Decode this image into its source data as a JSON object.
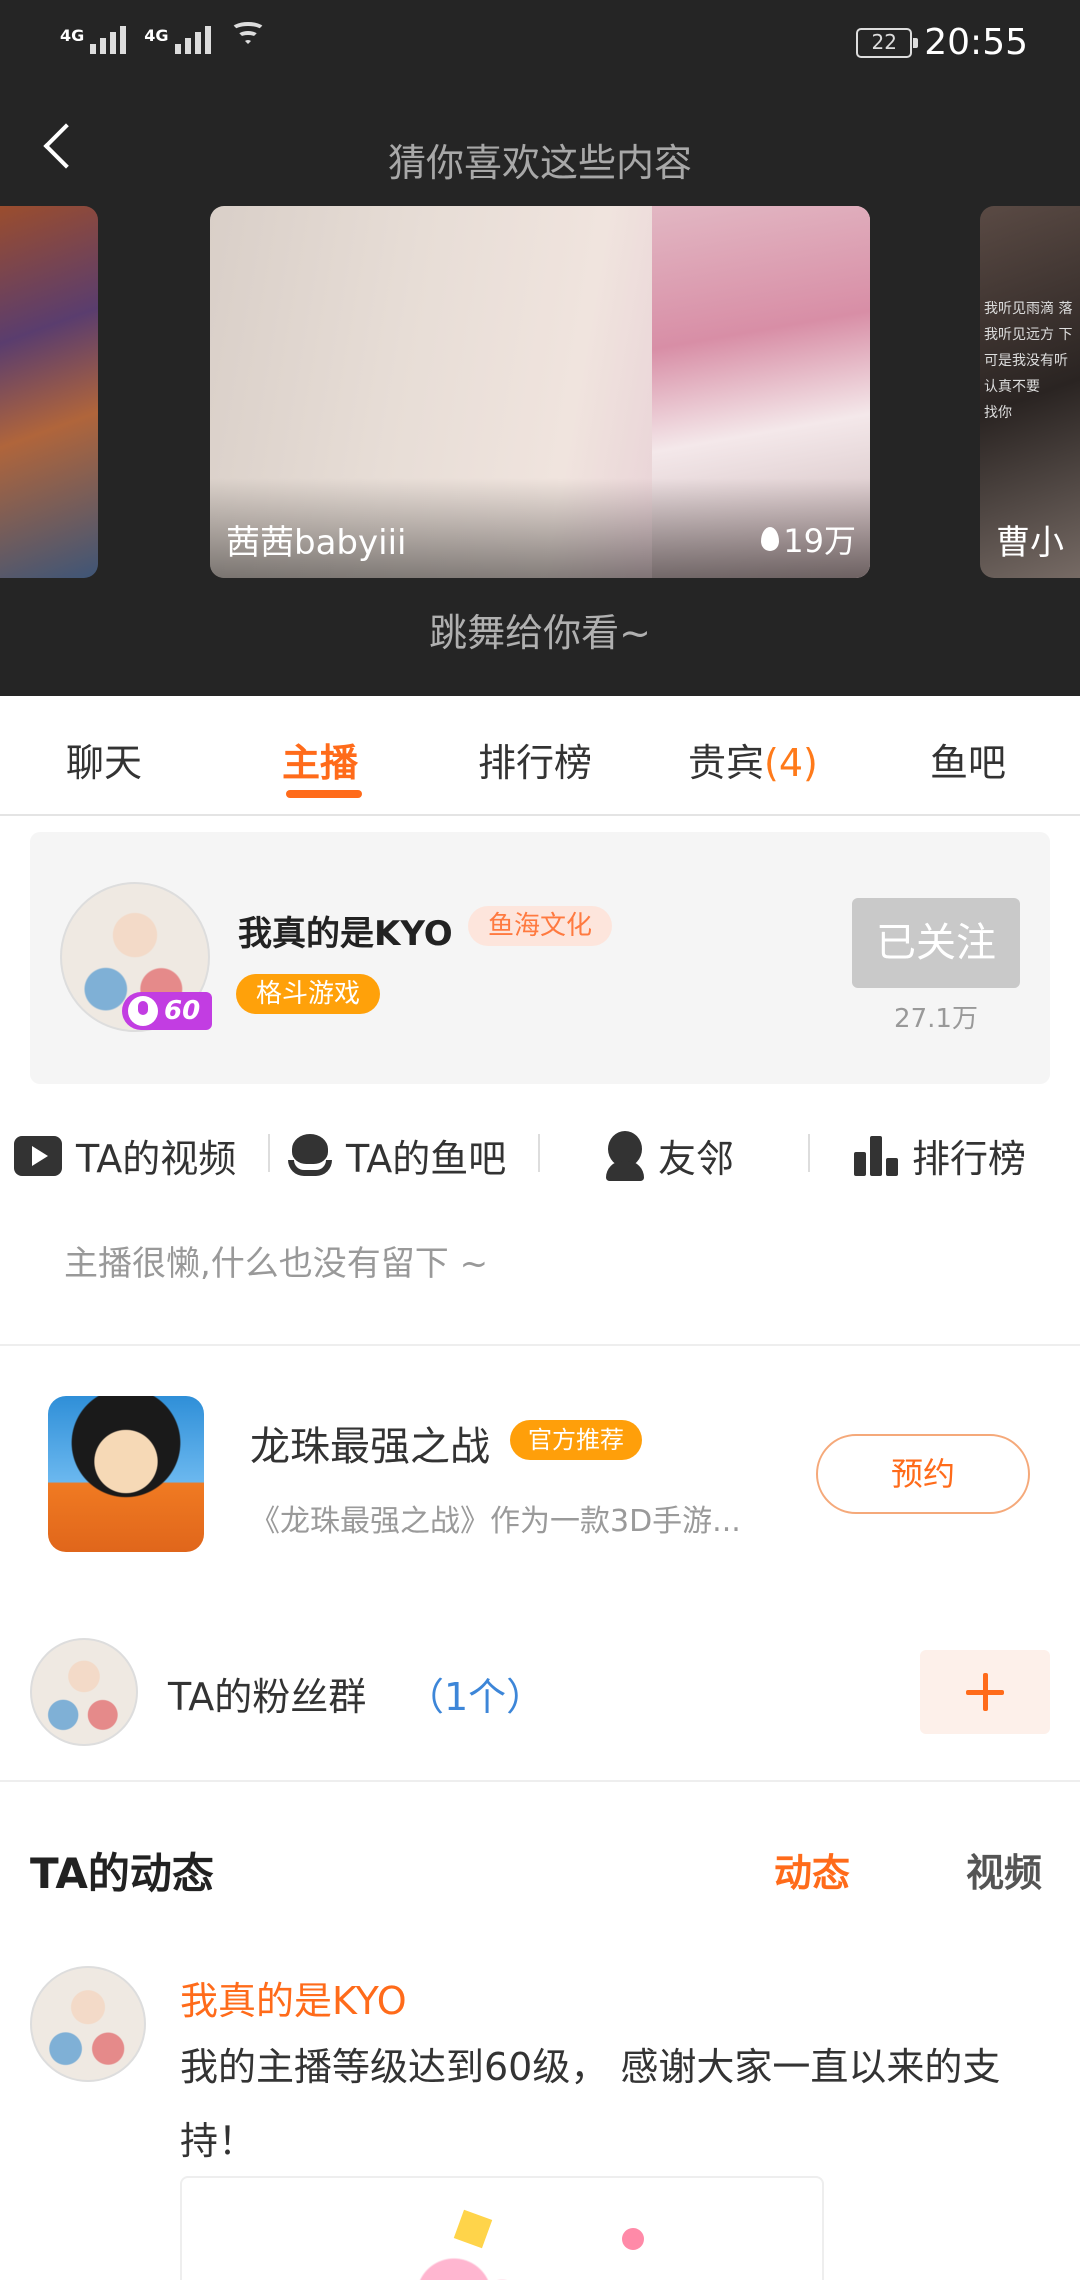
{
  "status_bar": {
    "signal1": "4G",
    "signal2": "4G",
    "battery": "22",
    "time": "20:55"
  },
  "recommend": {
    "title": "猜你喜欢这些内容",
    "main_card": {
      "name": "茜茜babyiii",
      "heat": "19万"
    },
    "right_card": {
      "name": "曹小",
      "overlay_text": [
        "我听见雨滴 落",
        "我听见远方 下",
        "可是我没有听",
        "认真不要",
        "找你"
      ]
    },
    "caption": "跳舞给你看~"
  },
  "tabs": [
    {
      "label": "聊天"
    },
    {
      "label": "主播"
    },
    {
      "label": "排行榜"
    },
    {
      "label": "贵宾",
      "count": "(4)"
    },
    {
      "label": "鱼吧"
    }
  ],
  "anchor": {
    "name": "我真的是KYO",
    "org": "鱼海文化",
    "category": "格斗游戏",
    "level": "60",
    "follow_label": "已关注",
    "fans": "27.1万"
  },
  "links": [
    {
      "label": "TA的视频",
      "icon": "video-icon"
    },
    {
      "label": "TA的鱼吧",
      "icon": "fish-bar-icon"
    },
    {
      "label": "友邻",
      "icon": "user-icon"
    },
    {
      "label": "排行榜",
      "icon": "bar-chart-icon"
    }
  ],
  "description": "主播很懒,什么也没有留下 ~",
  "game": {
    "title": "龙珠最强之战",
    "tag": "官方推荐",
    "desc": "《龙珠最强之战》作为一款3D手游...",
    "button": "预约"
  },
  "fan_group": {
    "label": "TA的粉丝群",
    "count": "（1个）"
  },
  "feed": {
    "title": "TA的动态",
    "tabs": [
      "动态",
      "视频"
    ],
    "post": {
      "author": "我真的是KYO",
      "text": "我的主播等级达到60级， 感谢大家一直以来的支持！"
    }
  },
  "colors": {
    "accent": "#ff6b1a",
    "dark_header": "#252525",
    "link_blue": "#3d86d8"
  }
}
